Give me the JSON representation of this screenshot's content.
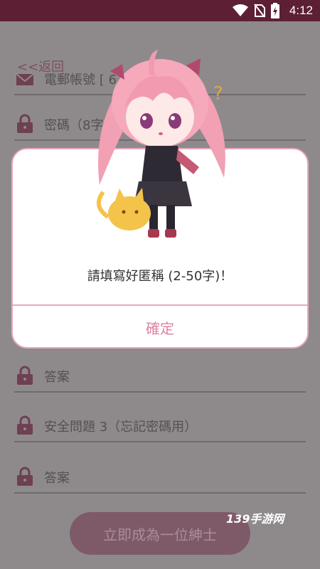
{
  "statusbar": {
    "time": "4:12"
  },
  "nav": {
    "back_label": "<<返回"
  },
  "form": {
    "account_hint": "電郵帳號 [ 6 字",
    "password_hint": "密碼（8字",
    "answer2_hint": "答案",
    "security_q3_hint": "安全問題 3（忘記密碼用）",
    "answer3_hint": "答案",
    "submit_label": "立即成為一位紳士"
  },
  "dialog": {
    "message": "請填寫好匿稱 (2-50字)！",
    "confirm_label": "確定"
  },
  "watermark": "139手游网",
  "colors": {
    "accent": "#e07fa3",
    "statusbar": "#5c1f33",
    "dialog_border": "#e8a8bf"
  }
}
